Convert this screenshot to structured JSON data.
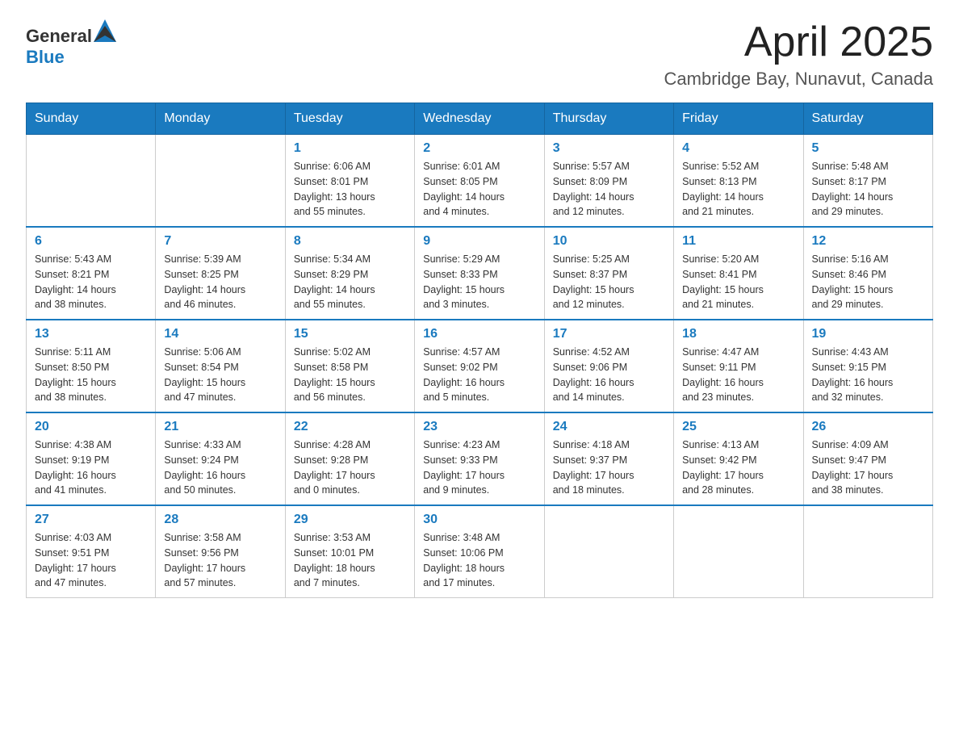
{
  "header": {
    "logo_general": "General",
    "logo_blue": "Blue",
    "month": "April 2025",
    "location": "Cambridge Bay, Nunavut, Canada"
  },
  "weekdays": [
    "Sunday",
    "Monday",
    "Tuesday",
    "Wednesday",
    "Thursday",
    "Friday",
    "Saturday"
  ],
  "weeks": [
    [
      {
        "day": "",
        "info": ""
      },
      {
        "day": "",
        "info": ""
      },
      {
        "day": "1",
        "info": "Sunrise: 6:06 AM\nSunset: 8:01 PM\nDaylight: 13 hours\nand 55 minutes."
      },
      {
        "day": "2",
        "info": "Sunrise: 6:01 AM\nSunset: 8:05 PM\nDaylight: 14 hours\nand 4 minutes."
      },
      {
        "day": "3",
        "info": "Sunrise: 5:57 AM\nSunset: 8:09 PM\nDaylight: 14 hours\nand 12 minutes."
      },
      {
        "day": "4",
        "info": "Sunrise: 5:52 AM\nSunset: 8:13 PM\nDaylight: 14 hours\nand 21 minutes."
      },
      {
        "day": "5",
        "info": "Sunrise: 5:48 AM\nSunset: 8:17 PM\nDaylight: 14 hours\nand 29 minutes."
      }
    ],
    [
      {
        "day": "6",
        "info": "Sunrise: 5:43 AM\nSunset: 8:21 PM\nDaylight: 14 hours\nand 38 minutes."
      },
      {
        "day": "7",
        "info": "Sunrise: 5:39 AM\nSunset: 8:25 PM\nDaylight: 14 hours\nand 46 minutes."
      },
      {
        "day": "8",
        "info": "Sunrise: 5:34 AM\nSunset: 8:29 PM\nDaylight: 14 hours\nand 55 minutes."
      },
      {
        "day": "9",
        "info": "Sunrise: 5:29 AM\nSunset: 8:33 PM\nDaylight: 15 hours\nand 3 minutes."
      },
      {
        "day": "10",
        "info": "Sunrise: 5:25 AM\nSunset: 8:37 PM\nDaylight: 15 hours\nand 12 minutes."
      },
      {
        "day": "11",
        "info": "Sunrise: 5:20 AM\nSunset: 8:41 PM\nDaylight: 15 hours\nand 21 minutes."
      },
      {
        "day": "12",
        "info": "Sunrise: 5:16 AM\nSunset: 8:46 PM\nDaylight: 15 hours\nand 29 minutes."
      }
    ],
    [
      {
        "day": "13",
        "info": "Sunrise: 5:11 AM\nSunset: 8:50 PM\nDaylight: 15 hours\nand 38 minutes."
      },
      {
        "day": "14",
        "info": "Sunrise: 5:06 AM\nSunset: 8:54 PM\nDaylight: 15 hours\nand 47 minutes."
      },
      {
        "day": "15",
        "info": "Sunrise: 5:02 AM\nSunset: 8:58 PM\nDaylight: 15 hours\nand 56 minutes."
      },
      {
        "day": "16",
        "info": "Sunrise: 4:57 AM\nSunset: 9:02 PM\nDaylight: 16 hours\nand 5 minutes."
      },
      {
        "day": "17",
        "info": "Sunrise: 4:52 AM\nSunset: 9:06 PM\nDaylight: 16 hours\nand 14 minutes."
      },
      {
        "day": "18",
        "info": "Sunrise: 4:47 AM\nSunset: 9:11 PM\nDaylight: 16 hours\nand 23 minutes."
      },
      {
        "day": "19",
        "info": "Sunrise: 4:43 AM\nSunset: 9:15 PM\nDaylight: 16 hours\nand 32 minutes."
      }
    ],
    [
      {
        "day": "20",
        "info": "Sunrise: 4:38 AM\nSunset: 9:19 PM\nDaylight: 16 hours\nand 41 minutes."
      },
      {
        "day": "21",
        "info": "Sunrise: 4:33 AM\nSunset: 9:24 PM\nDaylight: 16 hours\nand 50 minutes."
      },
      {
        "day": "22",
        "info": "Sunrise: 4:28 AM\nSunset: 9:28 PM\nDaylight: 17 hours\nand 0 minutes."
      },
      {
        "day": "23",
        "info": "Sunrise: 4:23 AM\nSunset: 9:33 PM\nDaylight: 17 hours\nand 9 minutes."
      },
      {
        "day": "24",
        "info": "Sunrise: 4:18 AM\nSunset: 9:37 PM\nDaylight: 17 hours\nand 18 minutes."
      },
      {
        "day": "25",
        "info": "Sunrise: 4:13 AM\nSunset: 9:42 PM\nDaylight: 17 hours\nand 28 minutes."
      },
      {
        "day": "26",
        "info": "Sunrise: 4:09 AM\nSunset: 9:47 PM\nDaylight: 17 hours\nand 38 minutes."
      }
    ],
    [
      {
        "day": "27",
        "info": "Sunrise: 4:03 AM\nSunset: 9:51 PM\nDaylight: 17 hours\nand 47 minutes."
      },
      {
        "day": "28",
        "info": "Sunrise: 3:58 AM\nSunset: 9:56 PM\nDaylight: 17 hours\nand 57 minutes."
      },
      {
        "day": "29",
        "info": "Sunrise: 3:53 AM\nSunset: 10:01 PM\nDaylight: 18 hours\nand 7 minutes."
      },
      {
        "day": "30",
        "info": "Sunrise: 3:48 AM\nSunset: 10:06 PM\nDaylight: 18 hours\nand 17 minutes."
      },
      {
        "day": "",
        "info": ""
      },
      {
        "day": "",
        "info": ""
      },
      {
        "day": "",
        "info": ""
      }
    ]
  ]
}
